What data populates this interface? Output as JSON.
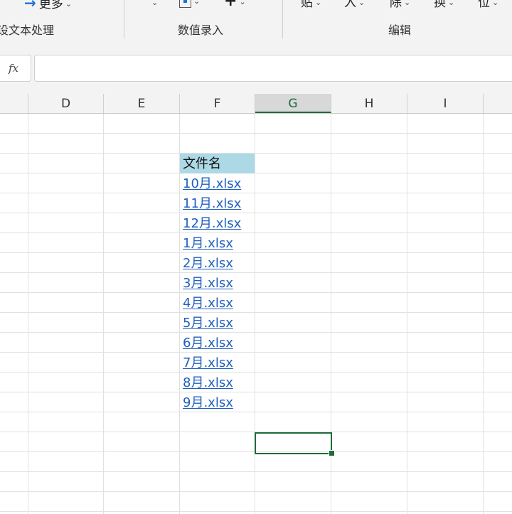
{
  "ribbon": {
    "more_label": "更多",
    "groups": [
      {
        "label": "设文本处理"
      },
      {
        "label": "数值录入"
      },
      {
        "label": "编辑"
      }
    ],
    "edit_items": [
      {
        "label": "贴"
      },
      {
        "label": "入"
      },
      {
        "label": "除"
      },
      {
        "label": "换"
      },
      {
        "label": "位"
      }
    ],
    "icons": [
      "arrow-right-icon",
      "chevron-down-icon",
      "insert-box-icon",
      "plus-icon"
    ]
  },
  "formula_bar": {
    "fx_label": "fx",
    "value": ""
  },
  "columns": [
    {
      "label": "D"
    },
    {
      "label": "E"
    },
    {
      "label": "F"
    },
    {
      "label": "G",
      "selected": true
    },
    {
      "label": "H"
    },
    {
      "label": "I"
    }
  ],
  "sheet": {
    "header": "文件名",
    "files": [
      "10月.xlsx",
      "11月.xlsx",
      "12月.xlsx",
      "1月.xlsx",
      "2月.xlsx",
      "3月.xlsx",
      "4月.xlsx",
      "5月.xlsx",
      "6月.xlsx",
      "7月.xlsx",
      "8月.xlsx",
      "9月.xlsx"
    ]
  },
  "colors": {
    "header_fill": "#add8e6",
    "link": "#1f5fbf",
    "selection": "#1e6b3a"
  }
}
